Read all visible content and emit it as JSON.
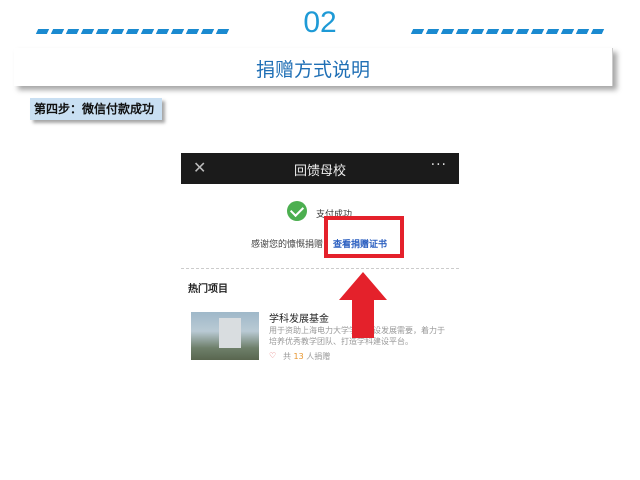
{
  "slide": {
    "number": "02",
    "title": "捐赠方式说明",
    "step_label": "第四步：微信付款成功"
  },
  "phone": {
    "nav": {
      "close_icon": "close-icon",
      "title": "回馈母校",
      "more": "···"
    },
    "status": "支付成功",
    "thanks": "感谢您的慷慨捐赠",
    "cert_link": "查看捐赠证书",
    "hot_title": "热门项目",
    "project": {
      "name": "学科发展基金",
      "desc": "用于资助上海电力大学学科建设发展需要，着力于培养优秀教学团队、打造学科建设平台。",
      "donors_prefix": "共",
      "donors_count": "13",
      "donors_suffix": "人捐赠"
    }
  },
  "colors": {
    "accent": "#1e9ad6",
    "title": "#1f6fb5",
    "highlight": "#e4212b",
    "success": "#4caf50"
  }
}
